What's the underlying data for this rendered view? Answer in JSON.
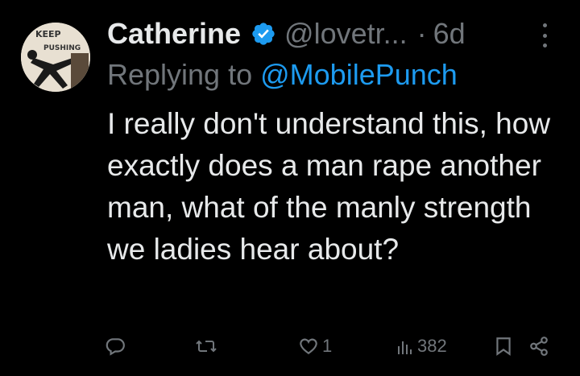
{
  "tweet": {
    "author_name": "Catherine",
    "handle": "@lovetr...",
    "separator": "·",
    "timestamp": "6d",
    "replying_prefix": "Replying to",
    "replying_to": "@MobilePunch",
    "body": "I really don't understand this, how exactly does a man rape another man, what of the manly strength we ladies hear about?",
    "avatar_text_line1": "KEEP",
    "avatar_text_line2": "PUSHING"
  },
  "actions": {
    "reply_count": "",
    "retweet_count": "",
    "like_count": "1",
    "views_count": "382"
  },
  "icons": {
    "reply": "reply-icon",
    "retweet": "retweet-icon",
    "like": "heart-icon",
    "views": "views-icon",
    "bookmark": "bookmark-icon",
    "share": "share-icon",
    "verified": "verified-badge-icon",
    "more": "more-icon"
  },
  "colors": {
    "background": "#000000",
    "text": "#e7e9ea",
    "muted": "#71767b",
    "accent": "#1d9bf0"
  }
}
